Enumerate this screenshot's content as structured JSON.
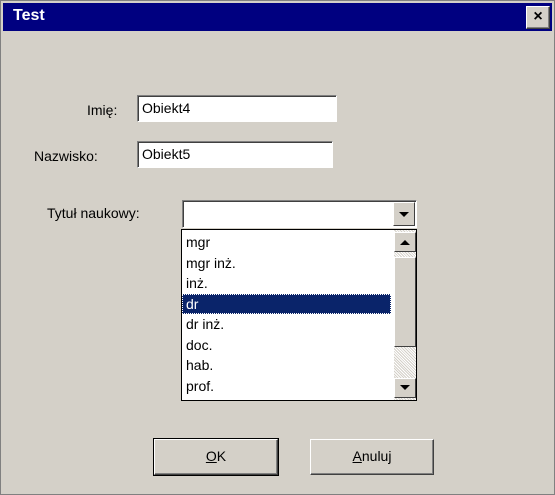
{
  "window": {
    "title": "Test",
    "close_label": "×"
  },
  "form": {
    "first_name_label": "Imię:",
    "first_name_value": "Obiekt4",
    "last_name_label": "Nazwisko:",
    "last_name_value": "Obiekt5",
    "title_label": "Tytuł naukowy:",
    "title_value": ""
  },
  "dropdown": {
    "items": [
      "mgr",
      "mgr inż.",
      "inż.",
      "dr",
      "dr inż.",
      "doc.",
      "hab.",
      "prof."
    ],
    "selected_index": 3
  },
  "buttons": {
    "ok_mnemonic": "O",
    "ok_rest": "K",
    "cancel_mnemonic": "A",
    "cancel_rest": "nuluj"
  },
  "colors": {
    "title_bar": "#000080",
    "selection": "#0a246a",
    "face": "#d4d0c8"
  }
}
